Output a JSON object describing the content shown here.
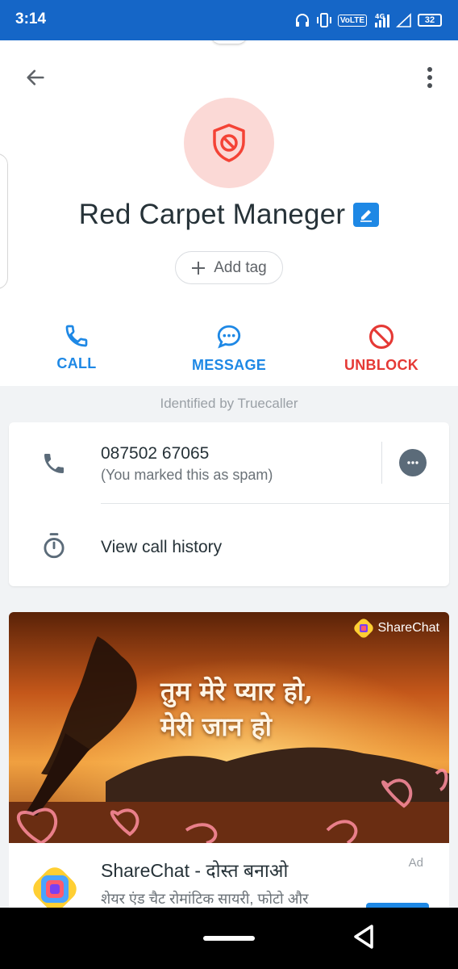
{
  "status_bar": {
    "time": "3:14",
    "network_label": "VoLTE",
    "network_type": "4G",
    "battery": "32",
    "icons": [
      "headphones-icon",
      "vibrate-icon",
      "signal-icon",
      "signal-empty-icon",
      "battery-icon"
    ]
  },
  "toolbar": {
    "back_icon": "arrow-left-icon",
    "more_icon": "more-vertical-icon"
  },
  "contact": {
    "name": "Red Carpet Maneger",
    "avatar_icon": "shield-block-icon",
    "edit_icon": "pencil-icon",
    "add_tag_label": "Add tag"
  },
  "actions": [
    {
      "label": "CALL",
      "icon": "phone-icon",
      "color": "#1e88e5"
    },
    {
      "label": "MESSAGE",
      "icon": "chat-bubble-icon",
      "color": "#1e88e5"
    },
    {
      "label": "UNBLOCK",
      "icon": "block-icon",
      "color": "#e53935"
    }
  ],
  "identified_text": "Identified by Truecaller",
  "number_card": {
    "number": "087502 67065",
    "note": "(You marked this as spam)",
    "history_label": "View call history"
  },
  "ad": {
    "brand": "ShareChat",
    "hindi_line1": "तुम मेरे प्यार हो,",
    "hindi_line2": "मेरी जान हो",
    "title": "ShareChat - दोस्त बनाओ",
    "description": "शेयर एंड चैट रोमांटिक सायरी, फोटो और",
    "tag": "Ad"
  },
  "colors": {
    "status_bar": "#1566c7",
    "accent": "#1e88e5",
    "danger": "#e53935",
    "avatar_bg": "#fbd9d6"
  }
}
